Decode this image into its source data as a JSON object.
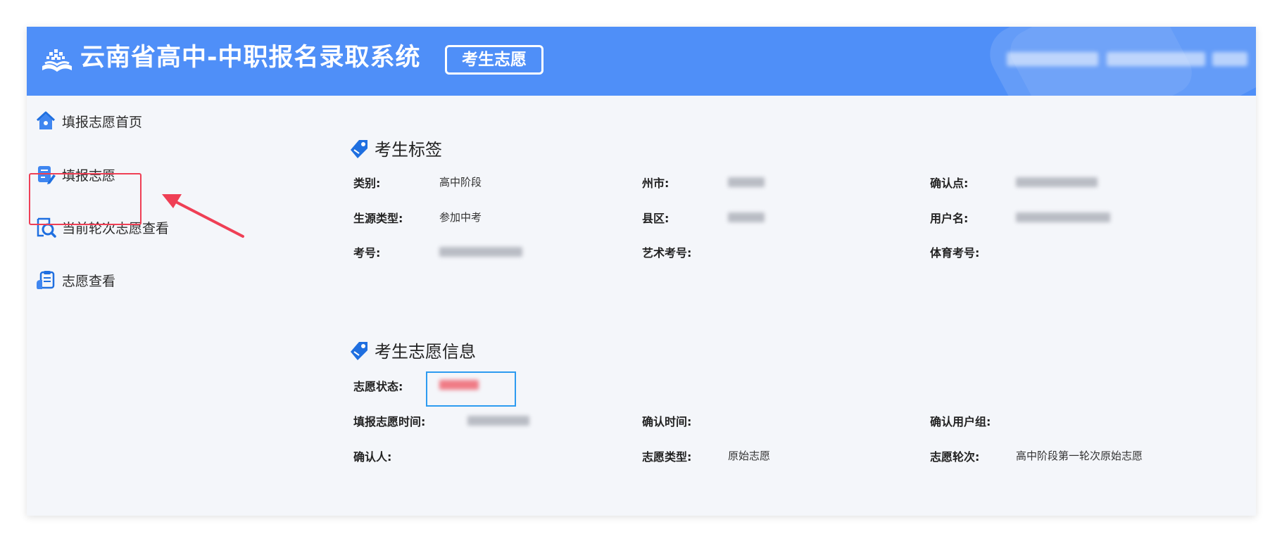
{
  "header": {
    "title": "云南省高中-中职报名录取系统",
    "badge": "考生志愿"
  },
  "sidebar": {
    "items": [
      {
        "label": "填报志愿首页",
        "icon": "home-icon"
      },
      {
        "label": "填报志愿",
        "icon": "edit-form-icon"
      },
      {
        "label": "当前轮次志愿查看",
        "icon": "search-document-icon"
      },
      {
        "label": "志愿查看",
        "icon": "clipboard-icon"
      }
    ]
  },
  "section_tags": {
    "title": "考生标签",
    "fields": [
      {
        "label": "类别:",
        "value": "高中阶段"
      },
      {
        "label": "州市:",
        "value": ""
      },
      {
        "label": "确认点:",
        "value": ""
      },
      {
        "label": "生源类型:",
        "value": "参加中考"
      },
      {
        "label": "县区:",
        "value": ""
      },
      {
        "label": "用户名:",
        "value": ""
      },
      {
        "label": "考号:",
        "value": ""
      },
      {
        "label": "艺术考号:",
        "value": ""
      },
      {
        "label": "体育考号:",
        "value": ""
      }
    ]
  },
  "section_info": {
    "title": "考生志愿信息",
    "fields": [
      {
        "label": "志愿状态:",
        "value": ""
      },
      {
        "label": "填报志愿时间:",
        "value": ""
      },
      {
        "label": "确认时间:",
        "value": ""
      },
      {
        "label": "确认用户组:",
        "value": ""
      },
      {
        "label": "确认人:",
        "value": ""
      },
      {
        "label": "志愿类型:",
        "value": "原始志愿"
      },
      {
        "label": "志愿轮次:",
        "value": "高中阶段第一轮次原始志愿"
      }
    ]
  },
  "colors": {
    "header_bg": "#4f8ff8",
    "accent": "#1f6fe0",
    "highlight_red": "#ef3f55",
    "status_box": "#2d9bf0"
  }
}
